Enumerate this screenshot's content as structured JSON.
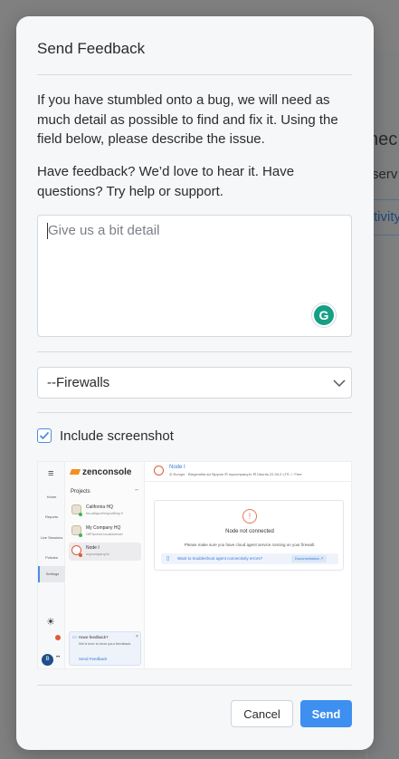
{
  "background": {
    "heading_fragment": "nec",
    "text_fragment": "serv",
    "button_fragment": "tivity"
  },
  "modal": {
    "title": "Send Feedback",
    "intro_paragraph": "If you have stumbled onto a bug, we will need as much detail as possible to find and fix it. Using the field below, please describe the issue.",
    "secondary_paragraph": "Have feedback? We’d love to hear it. Have questions? Try help or support.",
    "textarea_placeholder": "Give us a bit detail",
    "grammarly_icon": "G",
    "category_select_value": "--Firewalls",
    "include_screenshot_label": "Include screenshot",
    "include_screenshot_checked": true,
    "cancel_label": "Cancel",
    "send_label": "Send",
    "accent_color": "#3d8ff0"
  },
  "preview": {
    "logo_text": "zenconsole",
    "sidebar_items": [
      "Home",
      "Reports",
      "Live Sessions",
      "Policies",
      "Settings"
    ],
    "user_initial": "B",
    "user_dots": "••",
    "projects_title": "Projects",
    "projects": [
      {
        "name": "California HQ",
        "sub": "fw.caliquaHmycoBiny.fi"
      },
      {
        "name": "My Company HQ",
        "sub": "OfFiscesrt.localdomain"
      },
      {
        "name": "Node I",
        "sub": "mycompany.fo"
      }
    ],
    "feedback_box": {
      "title": "Have feedback?",
      "body": "We’d love to hear your feedback.",
      "link": "Send Feedback"
    },
    "node": {
      "title": "Node I",
      "meta": "◎ Europe · Bregenelia ad Sipyum   ⊟ mycompany.fo   ⊟ Ubuntu 22.04.2 LTS   ☆ Free",
      "status": "Node not connected",
      "message": "Please make sure you have cloud agent service running on your firewall.",
      "question": "Want to troubleshoot agent connectivity errors?",
      "doc_label": "Documentation ↗"
    }
  }
}
